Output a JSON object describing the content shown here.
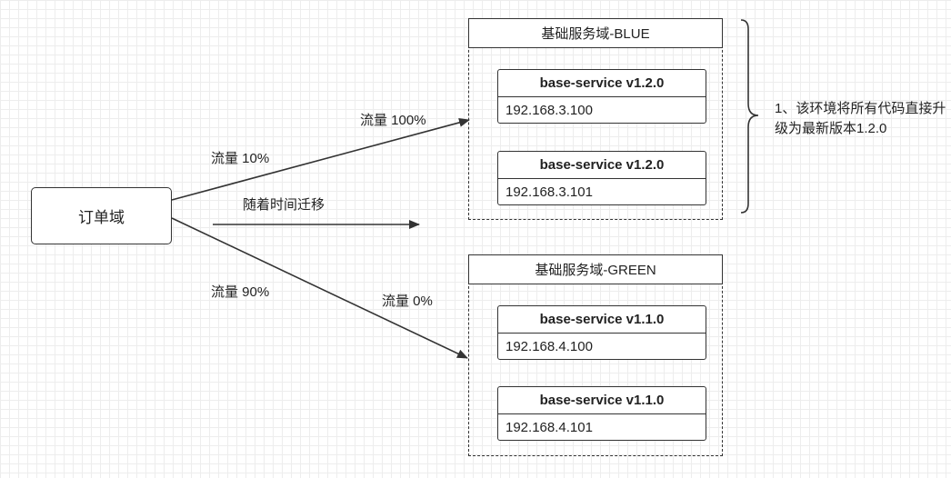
{
  "source": {
    "label": "订单域"
  },
  "edges": {
    "upper_start": "流量 10%",
    "upper_end": "流量 100%",
    "lower_start": "流量 90%",
    "lower_end": "流量 0%",
    "migration": "随着时间迁移"
  },
  "domains": [
    {
      "title": "基础服务域-BLUE",
      "services": [
        {
          "name": "base-service v1.2.0",
          "ip": "192.168.3.100"
        },
        {
          "name": "base-service v1.2.0",
          "ip": "192.168.3.101"
        }
      ]
    },
    {
      "title": "基础服务域-GREEN",
      "services": [
        {
          "name": "base-service v1.1.0",
          "ip": "192.168.4.100"
        },
        {
          "name": "base-service v1.1.0",
          "ip": "192.168.4.101"
        }
      ]
    }
  ],
  "note": {
    "text": "1、该环境将所有代码直接升级为最新版本1.2.0"
  },
  "colors": {
    "line": "#333333",
    "grid": "#ededed"
  }
}
